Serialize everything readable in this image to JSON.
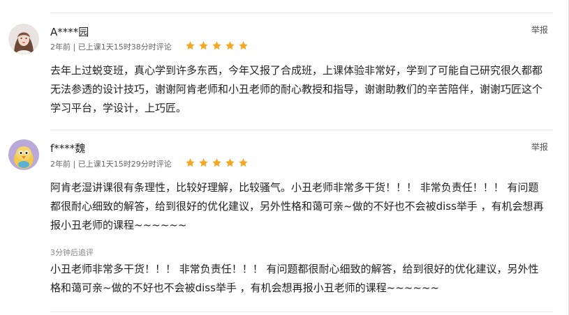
{
  "reviews": [
    {
      "username": "A****园",
      "report_label": "举报",
      "meta": "2年前 | 已上课1天15时38分时评论",
      "rating": 5,
      "content": "去年上过蜕变班，真心学到许多东西，今年又报了合成班，上课体验非常好，学到了可能自己研究很久都都无法参透的设计技巧，谢谢阿肯老师和小丑老师的耐心教授和指导，谢谢助教们的辛苦陪伴，谢谢巧匠这个学习平台，学设计，上巧匠。"
    },
    {
      "username": "f****魏",
      "report_label": "举报",
      "meta": "2年前 | 已上课1天15时29分时评论",
      "rating": 5,
      "content": "阿肯老湿讲课很有条理性，比较好理解，比较骚气。小丑老师非常多干货！！！ 非常负责任！！！ 有问题都很耐心细致的解答，给到很好的优化建议，另外性格和蔼可亲~做的不好也不会被diss举手 ，有机会想再报小丑老师的课程~~~~~~",
      "followup_label": "3分钟后追评",
      "followup_content": "小丑老师非常多干货！！！ 非常负责任！！！ 有问题都很耐心细致的解答，给到很好的优化建议，另外性格和蔼可亲~做的不好也不会被diss举手 ，有机会想再报小丑老师的课程~~~~~~"
    }
  ],
  "colors": {
    "star": "#f5a623",
    "separator": "#ebebeb",
    "meta_text": "#666666"
  },
  "icons": {
    "star": "star-icon",
    "avatar1": "woman-portrait-avatar",
    "avatar2": "cartoon-bird-avatar"
  }
}
